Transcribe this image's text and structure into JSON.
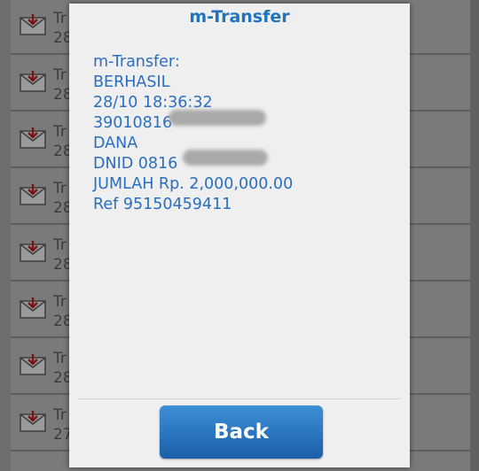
{
  "background_list": {
    "rows": [
      {
        "line1": "Tr",
        "line2": "28"
      },
      {
        "line1": "Tr",
        "line2": "28"
      },
      {
        "line1": "Tr",
        "line2": "28"
      },
      {
        "line1": "Tr",
        "line2": "28"
      },
      {
        "line1": "Tr",
        "line2": "28"
      },
      {
        "line1": "Tr",
        "line2": "28"
      },
      {
        "line1": "Tr",
        "line2": "28"
      },
      {
        "line1": "Tr",
        "line2": "27"
      }
    ],
    "row_icon": "mail-icon"
  },
  "dialog": {
    "title": "m-Transfer",
    "message_lines": [
      "m-Transfer:",
      "BERHASIL",
      "28/10 18:36:32",
      "39010816",
      "DANA",
      "DNID 0816",
      "JUMLAH Rp. 2,000,000.00",
      "Ref 95150459411"
    ],
    "back_label": "Back"
  }
}
